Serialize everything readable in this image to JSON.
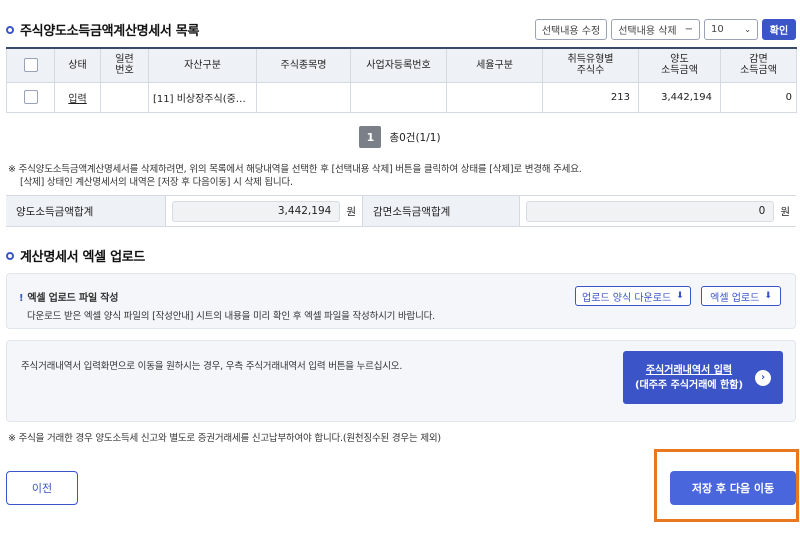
{
  "header": {
    "title": "주식양도소득금액계산명세서 목록",
    "edit_label": "선택내용 수정",
    "delete_label": "선택내용 삭제",
    "delete_symbol": "−",
    "page_size": "10",
    "confirm_label": "확인"
  },
  "table": {
    "columns": [
      "상태",
      "일련\n번호",
      "자산구분",
      "주식종목명",
      "사업자등록번호",
      "세율구분",
      "취득유형별\n주식수",
      "양도\n소득금액",
      "감면\n소득금액"
    ],
    "rows": [
      {
        "status": "입력",
        "serial": "",
        "asset_type": "[11] 비상장주식(중…",
        "stock_name": "",
        "biz_no": "",
        "tax_rate": "",
        "shares": "213",
        "transfer_income": "3,442,194",
        "reduction_income": "0"
      }
    ]
  },
  "pagination": {
    "current": "1",
    "summary": "총0건(1/1)"
  },
  "notice": {
    "line1": "※ 주식양도소득금액계산명세서를 삭제하려면, 위의 목록에서 해당내역을 선택한 후 [선택내용 삭제] 버튼을 클릭하여 상태를 [삭제]로 변경해 주세요.",
    "line2": "[삭제] 상태인 계산명세서의 내역은 [저장 후 다음이동] 시 삭제 됩니다."
  },
  "totals": {
    "transfer_label": "양도소득금액합계",
    "transfer_value": "3,442,194",
    "reduction_label": "감면소득금액합계",
    "reduction_value": "0",
    "unit": "원"
  },
  "upload": {
    "title": "계산명세서 엑셀 업로드",
    "box_title_mark": "!",
    "box_title": "엑셀 업로드 파일 작성",
    "box_desc": "다운로드 받은 엑셀 양식 파일의 [작성안내] 시트의 내용을 미리 확인 후 엑셀 파일을 작성하시기 바랍니다.",
    "download_label": "업로드 양식 다운로드",
    "excel_upload_label": "엑셀 업로드",
    "trade_desc": "주식거래내역서 입력화면으로 이동을 원하시는 경우, 우측 주식거래내역서 입력 버튼을 누르십시오.",
    "trade_btn_line1": "주식거래내역서 입력",
    "trade_btn_line2": "(대주주 주식거래에 한함)"
  },
  "footer": {
    "notice": "※ 주식을 거래한 경우 양도소득세 신고와 별도로 증권거래세를 신고납부하여야 합니다.(원천징수된 경우는 제외)",
    "prev_label": "이전",
    "save_next_label": "저장 후 다음 이동"
  },
  "colors": {
    "accent": "#3b55c8",
    "highlight": "#e8771e"
  }
}
